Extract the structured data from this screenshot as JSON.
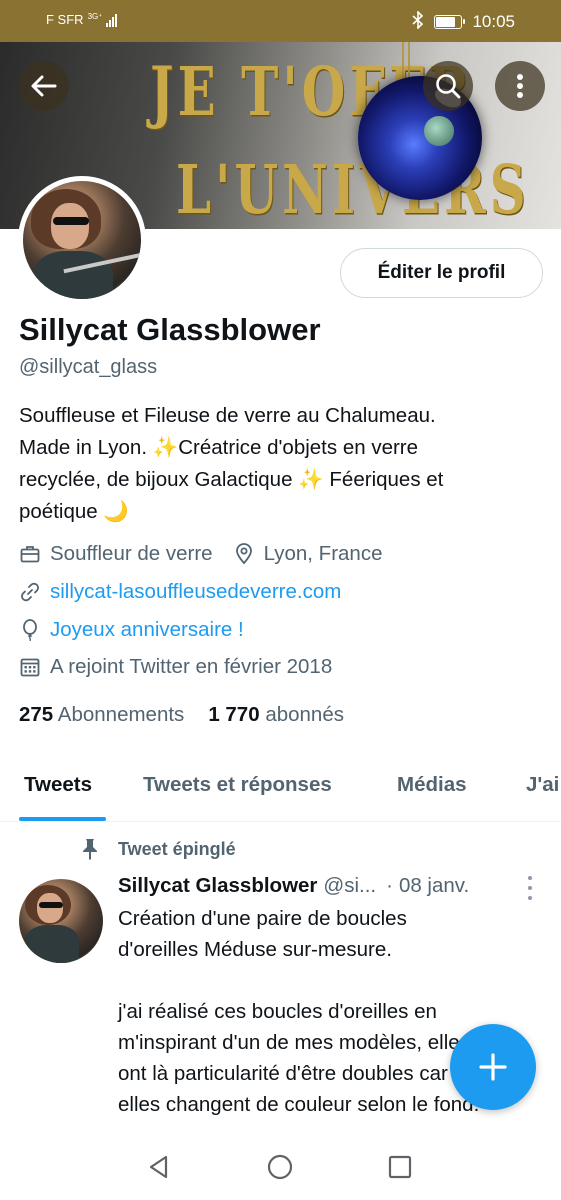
{
  "status_bar": {
    "carrier": "F SFR",
    "network": "3G⁺",
    "time": "10:05"
  },
  "banner": {
    "line1": "JE T'OFFR",
    "line2": "L'UNIVERS"
  },
  "profile": {
    "edit_label": "Éditer le profil",
    "display_name": "Sillycat Glassblower",
    "handle": "@sillycat_glass",
    "bio_line1": "Souffleuse et Fileuse de verre au Chalumeau.",
    "bio_line2a": "Made in Lyon. ",
    "bio_sparkle": "✨",
    "bio_line2b": "Créatrice d'objets en verre",
    "bio_line3a": "recyclée,  de bijoux Galactique ",
    "bio_line3b": " Féeriques et",
    "bio_line4": "poétique ",
    "bio_moon": "🌙",
    "job": "Souffleur de verre",
    "location": "Lyon, France",
    "website": "sillycat-lasouffleusedeverre.com",
    "birthday": "Joyeux anniversaire !",
    "joined": "A rejoint Twitter en février 2018",
    "following_count": "275",
    "following_label": "Abonnements",
    "followers_count": "1 770",
    "followers_label": "abonnés"
  },
  "tabs": [
    "Tweets",
    "Tweets et réponses",
    "Médias",
    "J'ai"
  ],
  "tweet": {
    "pinned_label": "Tweet épinglé",
    "author": "Sillycat Glassblower",
    "handle": "@si...",
    "separator": "·",
    "date": "08 janv.",
    "body": "Création d'une paire de boucles\nd'oreilles Méduse sur-mesure.\n\nj'ai réalisé ces boucles d'oreilles en\nm'inspirant d'un de mes modèles, elles\nont là particularité d'être doubles car\nelles changent de couleur selon le fond."
  },
  "colors": {
    "accent": "#1d9bf0",
    "status_bar": "#8a7332",
    "text": "#0f1419",
    "muted": "#536471"
  },
  "icons": [
    "back-arrow-icon",
    "search-icon",
    "more-vertical-icon",
    "briefcase-icon",
    "location-pin-icon",
    "link-icon",
    "balloon-icon",
    "calendar-icon",
    "pin-icon",
    "compose-plus-icon",
    "nav-back-icon",
    "nav-home-icon",
    "nav-recents-icon"
  ]
}
